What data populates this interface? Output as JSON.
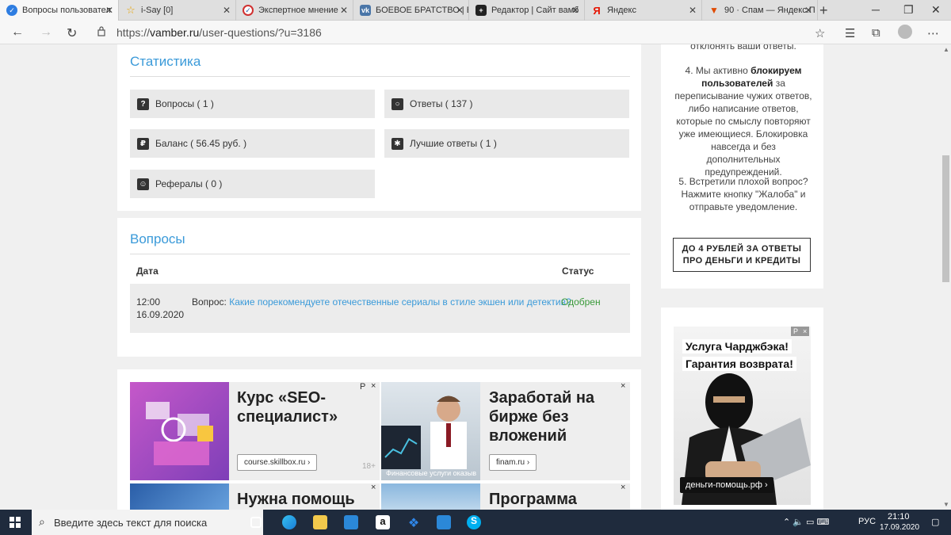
{
  "browser": {
    "tabs": [
      {
        "title": "Вопросы пользовател",
        "active": true,
        "favicon": "check-icon",
        "color": "#2e7de1"
      },
      {
        "title": "i-Say [0]",
        "favicon": "star-icon",
        "color": "#e8a400"
      },
      {
        "title": "Экспертное мнение",
        "favicon": "chart-icon",
        "color": "#d03030"
      },
      {
        "title": "БОЕВОЕ БРАТСТВО | В",
        "favicon": "vk-icon",
        "color": "#4a76a8"
      },
      {
        "title": "Редактор | Сайт вамб",
        "favicon": "plus-icon",
        "color": "#222222"
      },
      {
        "title": "Яндекс",
        "favicon": "yandex-icon",
        "color": "#e61400"
      },
      {
        "title": "90 · Спам — Яндекс.П",
        "favicon": "mail-icon",
        "color": "#f0a000"
      }
    ],
    "url_prefix": "https://",
    "url_host": "vamber.ru",
    "url_path": "/user-questions/?u=3186"
  },
  "stats": {
    "title": "Статистика",
    "items": [
      {
        "label": "Вопросы ( 1 )",
        "icon": "question-icon",
        "glyph": "?"
      },
      {
        "label": "Ответы ( 137 )",
        "icon": "speech-bubble-icon",
        "glyph": "○"
      },
      {
        "label": "Баланс ( 56.45 руб. )",
        "icon": "ruble-icon",
        "glyph": "₽"
      },
      {
        "label": "Лучшие ответы ( 1 )",
        "icon": "asterisk-icon",
        "glyph": "✱"
      },
      {
        "label": "Рефералы ( 0 )",
        "icon": "referral-user-icon",
        "glyph": "👤"
      }
    ]
  },
  "questions": {
    "title": "Вопросы",
    "col_date": "Дата",
    "col_status": "Статус",
    "row": {
      "time": "12:00",
      "date": "16.09.2020",
      "prefix": "Вопрос:",
      "link": "Какие порекомендуете отечественные сериалы в стиле экшен или детектив?",
      "status": "Одобрен"
    }
  },
  "sidebar": {
    "top_text": "отклонять ваши ответы.",
    "rule4_num": "4. Мы активно ",
    "rule4_bold": "блокируем пользователей",
    "rule4_rest": " за переписывание чужих ответов, либо написание ответов, которые по смыслу повторяют уже имеющиеся. Блокировка навсегда и без дополнительных предупреждений.",
    "rule5": "5. Встретили плохой вопрос? Нажмите кнопку \"Жалоба\" и отправьте уведомление.",
    "promo": "ДО 4 РУБЛЕЙ ЗА ОТВЕТЫ ПРО ДЕНЬГИ И КРЕДИТЫ"
  },
  "ads": {
    "ad1_title": "Курс «SEO-специалист»",
    "ad1_btn": "course.skillbox.ru",
    "ad1_age": "18+",
    "ad2_title": "Заработай на бирже без вложений",
    "ad2_btn": "finam.ru",
    "ad2_caption": "Финансовые услуги оказыв",
    "ad3_title": "Нужна помощь",
    "ad4_title": "Программа",
    "side_ad_line1": "Услуга Чарджбэка!",
    "side_ad_line2": "Гарантия возврата!",
    "side_ad_btn": "деньги-помощь.рф",
    "mark_p": "P",
    "close": "×"
  },
  "taskbar": {
    "search_placeholder": "Введите здесь текст для поиска",
    "lang": "РУС",
    "time": "21:10",
    "date": "17.09.2020"
  }
}
